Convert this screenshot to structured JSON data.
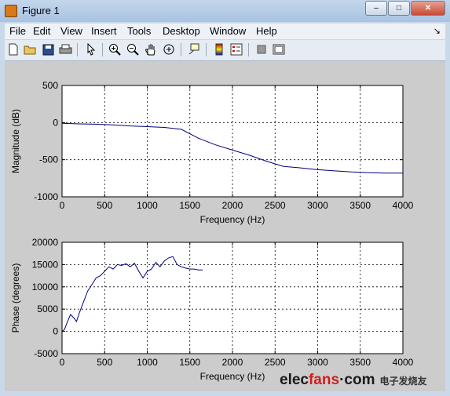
{
  "window": {
    "title": "Figure 1"
  },
  "window_controls": {
    "minimize": "–",
    "maximize": "□",
    "close": "✕"
  },
  "menu": [
    "File",
    "Edit",
    "View",
    "Insert",
    "Tools",
    "Desktop",
    "Window",
    "Help"
  ],
  "menu_arrow": "↘",
  "toolbar": {
    "icons": [
      "new-figure",
      "open-file",
      "save",
      "print",
      "edit-plot-arrow",
      "zoom-in",
      "zoom-out",
      "pan-hand",
      "rotate-3d",
      "data-cursor",
      "insert-colorbar",
      "insert-legend",
      "hide-plot-tools",
      "show-plot-tools"
    ]
  },
  "chart_data": [
    {
      "type": "line",
      "title": "",
      "xlabel": "Frequency (Hz)",
      "ylabel": "Magnitude (dB)",
      "xlim": [
        0,
        4000
      ],
      "ylim": [
        -1000,
        500
      ],
      "xticks": [
        0,
        500,
        1000,
        1500,
        2000,
        2500,
        3000,
        3500,
        4000
      ],
      "yticks": [
        500,
        0,
        -500,
        -1000
      ],
      "grid": true,
      "series": [
        {
          "color": "#00007f",
          "x": [
            0,
            200,
            400,
            600,
            800,
            1000,
            1200,
            1400,
            1600,
            1800,
            2000,
            2200,
            2400,
            2600,
            2800,
            3000,
            3200,
            3400,
            3600,
            3800,
            4000
          ],
          "y": [
            -10,
            -18,
            -22,
            -30,
            -45,
            -55,
            -65,
            -90,
            -210,
            -300,
            -370,
            -440,
            -520,
            -590,
            -610,
            -635,
            -650,
            -665,
            -675,
            -680,
            -680
          ]
        }
      ]
    },
    {
      "type": "line",
      "title": "",
      "xlabel": "Frequency (Hz)",
      "ylabel": "Phase (degrees)",
      "xlim": [
        0,
        4000
      ],
      "ylim": [
        -5000,
        20000
      ],
      "xticks": [
        0,
        500,
        1000,
        1500,
        2000,
        2500,
        3000,
        3500,
        4000
      ],
      "yticks": [
        20000,
        15000,
        10000,
        5000,
        0,
        -5000
      ],
      "grid": true,
      "series": [
        {
          "color": "#00007f",
          "x": [
            0,
            30,
            60,
            100,
            140,
            170,
            200,
            250,
            300,
            350,
            400,
            450,
            500,
            550,
            600,
            650,
            700,
            750,
            800,
            850,
            900,
            950,
            1000,
            1050,
            1100,
            1150,
            1200,
            1250,
            1300,
            1350,
            1400,
            1450,
            1500,
            1550,
            1600,
            1650
          ],
          "y": [
            0,
            500,
            2000,
            3800,
            3000,
            2200,
            4000,
            6500,
            9000,
            10500,
            12000,
            12500,
            13500,
            14500,
            14000,
            15000,
            14800,
            15200,
            14500,
            15300,
            13500,
            12000,
            13500,
            14000,
            15500,
            14500,
            15800,
            16500,
            16800,
            15000,
            14500,
            14200,
            14000,
            14000,
            13800,
            13800
          ]
        }
      ]
    }
  ],
  "watermark": {
    "logo_left": "elec",
    "logo_accent": "fans",
    "logo_right": "·com",
    "chinese": "电子发烧友"
  }
}
